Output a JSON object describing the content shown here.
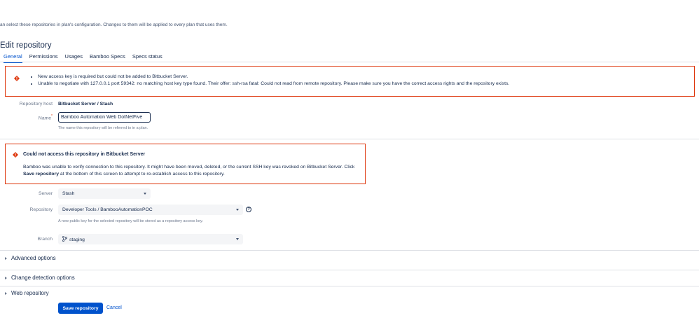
{
  "intro_text": "an select these repositories in plan's configuration. Changes to them will be applied to every plan that uses them.",
  "page_title": "Edit repository",
  "tabs": [
    {
      "label": "General",
      "active": true
    },
    {
      "label": "Permissions",
      "active": false
    },
    {
      "label": "Usages",
      "active": false
    },
    {
      "label": "Bamboo Specs",
      "active": false
    },
    {
      "label": "Specs status",
      "active": false
    }
  ],
  "top_warning": {
    "items": [
      "New access key is required but could not be added to Bitbucket Server.",
      "Unable to negotiate with 127.0.0.1 port 59342: no matching host key type found. Their offer: ssh-rsa fatal: Could not read from remote repository. Please make sure you have the correct access rights and the repository exists."
    ]
  },
  "form": {
    "repository_host_label": "Repository host",
    "repository_host_value": "Bitbucket Server / Stash",
    "name_label": "Name",
    "name_required_mark": "*",
    "name_value": "Bamboo Automation Web DotNetFive",
    "name_help": "The name this repository will be referred to in a plan.",
    "server_label": "Server",
    "server_value": "Stash",
    "repository_label": "Repository",
    "repository_value": "Developer Tools / BambooAutomationPOC",
    "repository_help_icon": "?",
    "repository_help": "A new public key for the selected repository will be stored as a repository access key.",
    "branch_label": "Branch",
    "branch_value": "staging"
  },
  "access_warning": {
    "title": "Could not access this repository in Bitbucket Server",
    "body_before": "Bamboo was unable to verify connection to this repository. It might have been moved, deleted, or the current SSH key was revoked on Bitbucket Server. Click ",
    "body_strong": "Save repository",
    "body_after": " at the bottom of this screen to attempt to re-establish access to this repository."
  },
  "sections": {
    "advanced": "Advanced options",
    "change_detection": "Change detection options",
    "web_repository": "Web repository"
  },
  "actions": {
    "save": "Save repository",
    "cancel": "Cancel"
  },
  "colors": {
    "error": "#de350b",
    "primary": "#0052cc",
    "text": "#172b4d",
    "subtle": "#6b778c"
  }
}
